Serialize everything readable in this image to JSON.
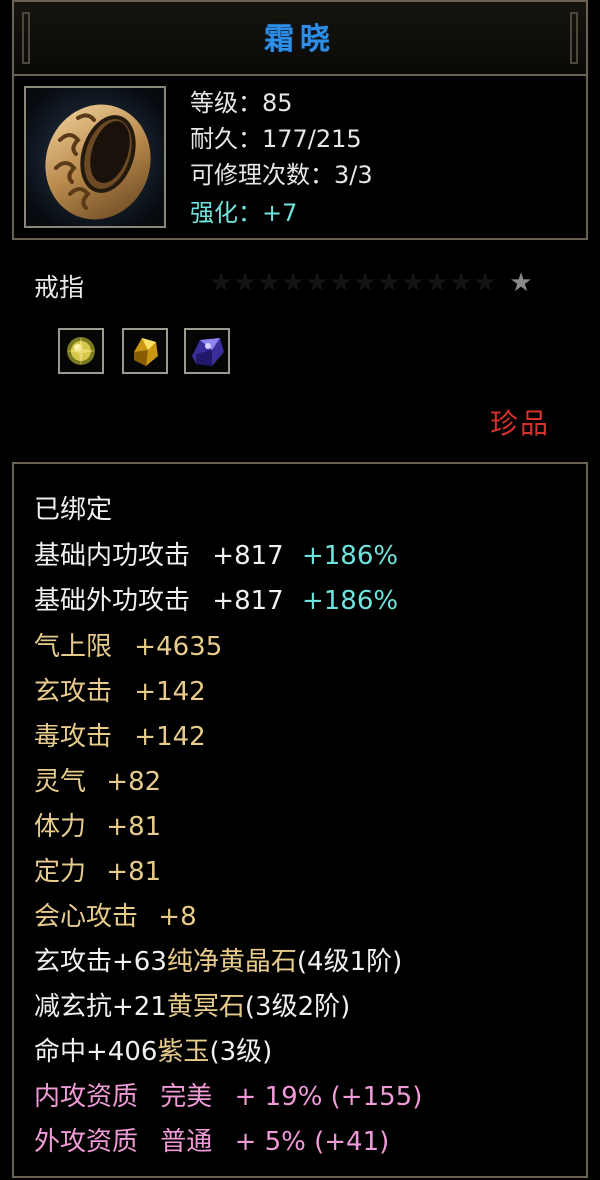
{
  "item": {
    "name": "霜晓",
    "level_label": "等级：85",
    "durability_label": "耐久：177/215",
    "repair_label": "可修理次数：3/3",
    "enhance_label": "强化：+7",
    "category": "戒指",
    "rarity": "珍品",
    "icon_name": "ring-icon"
  },
  "colors": {
    "title": "#2f8fe6",
    "enhance": "#6fe3dc",
    "rarity": "#d8302a",
    "gold_text": "#e7cb8b",
    "pink_text": "#f09ad8"
  },
  "stars": {
    "count": 13,
    "active_index": 12
  },
  "gems": [
    {
      "icon": "yellow-gem-round-icon"
    },
    {
      "icon": "yellow-gem-crystal-icon"
    },
    {
      "icon": "purple-gem-icon"
    }
  ],
  "attributes": {
    "bound": "已绑定",
    "base_inner": {
      "label": "基础内功攻击",
      "value": "+817",
      "percent": "+186%"
    },
    "base_outer": {
      "label": "基础外功攻击",
      "value": "+817",
      "percent": "+186%"
    },
    "qi": {
      "label": "气上限",
      "value": "+4635"
    },
    "xuan": {
      "label": "玄攻击",
      "value": "+142"
    },
    "poison": {
      "label": "毒攻击",
      "value": "+142"
    },
    "spirit": {
      "label": "灵气",
      "value": "+82"
    },
    "stamina": {
      "label": "体力",
      "value": "+81"
    },
    "focus": {
      "label": "定力",
      "value": "+81"
    },
    "crit": {
      "label": "会心攻击",
      "value": "+8"
    },
    "gem1": {
      "effect": "玄攻击+63",
      "name": "纯净黄晶石",
      "level": "(4级1阶)"
    },
    "gem2": {
      "effect": "减玄抗+21",
      "name": "黄冥石",
      "level": "(3级2阶)"
    },
    "gem3": {
      "effect": "命中+406",
      "name": "紫玉",
      "level": "(3级)"
    },
    "inner_quality": {
      "label": "内攻资质",
      "grade": "完美",
      "bonus": "+ 19% (+155)"
    },
    "outer_quality": {
      "label": "外攻资质",
      "grade": "普通",
      "bonus": "+ 5% (+41)"
    }
  }
}
